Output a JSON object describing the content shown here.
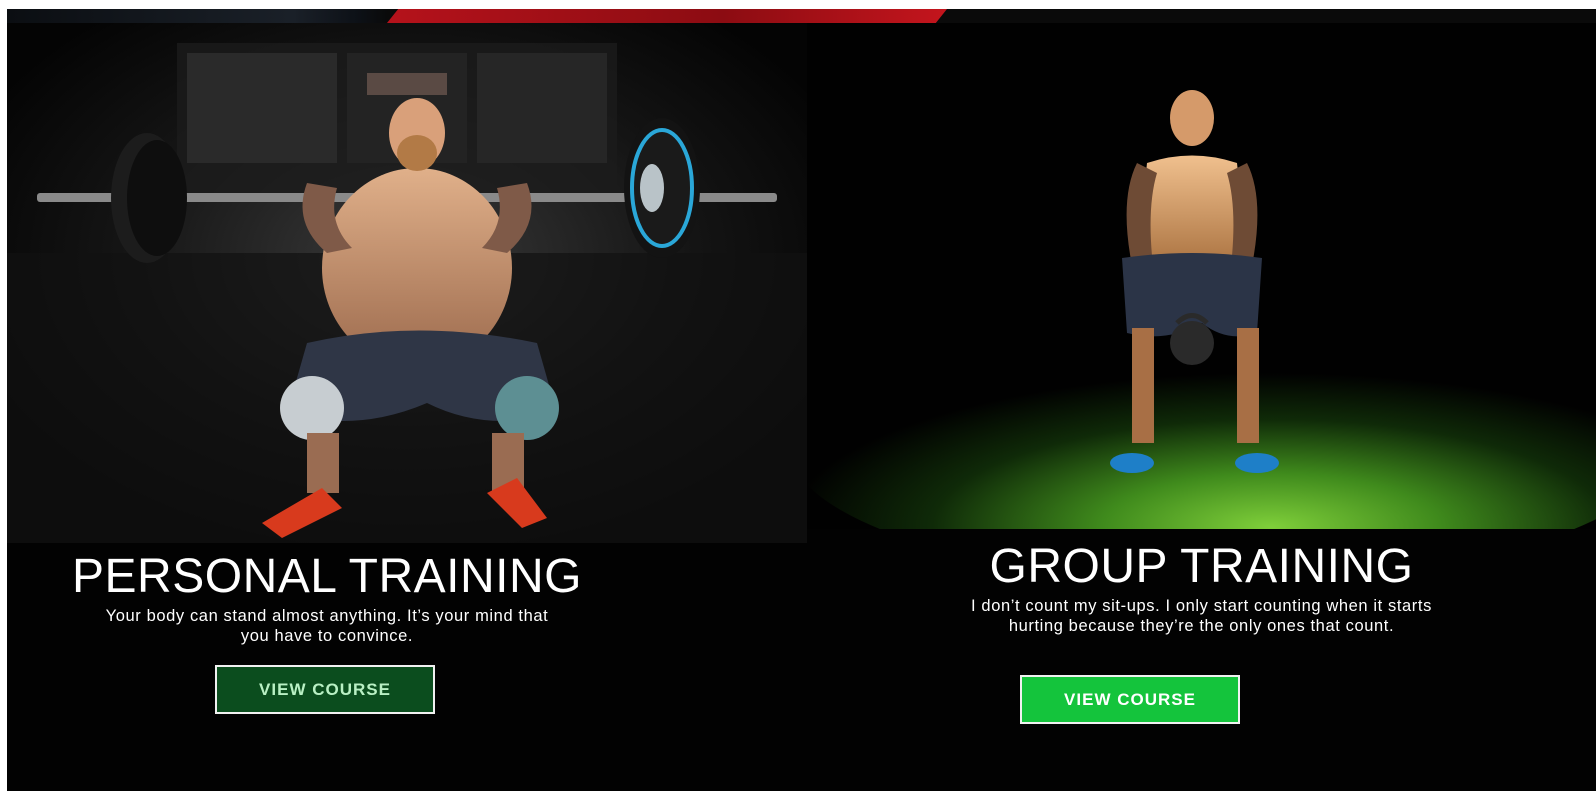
{
  "cards": [
    {
      "title": "PERSONAL TRAINING",
      "description": "Your body can stand almost anything. It’s your mind that you have to convince.",
      "button_label": "VIEW COURSE",
      "button_color": "#0b4d1e"
    },
    {
      "title": "GROUP TRAINING",
      "description": "I don’t count my sit-ups. I only start counting when it starts hurting because they’re the only ones that count.",
      "button_label": "VIEW COURSE",
      "button_color": "#14c43c"
    }
  ],
  "colors": {
    "background": "#020202",
    "accent_red": "#b5121b",
    "text": "#ffffff"
  }
}
